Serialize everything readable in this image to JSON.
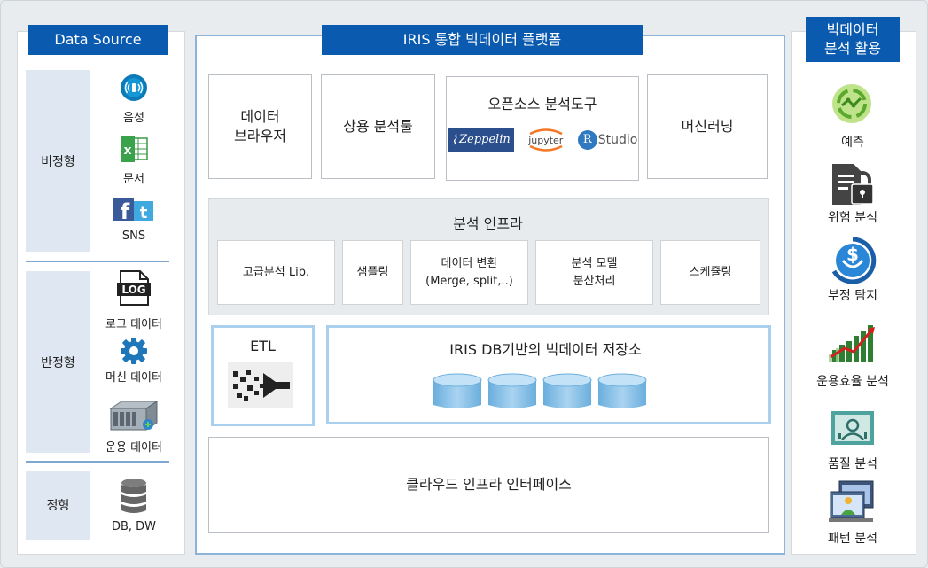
{
  "data_source": {
    "title": "Data Source",
    "categories": [
      {
        "label": "비정형",
        "items": [
          {
            "label": "음성",
            "icon": "audio-icon"
          },
          {
            "label": "문서",
            "icon": "excel-icon"
          },
          {
            "label": "SNS",
            "icon": "facebook-twitter-icon"
          }
        ]
      },
      {
        "label": "반정형",
        "items": [
          {
            "label": "로그 데이터",
            "icon": "log-file-icon",
            "icon_text": "LOG"
          },
          {
            "label": "머신 데이터",
            "icon": "gear-icon"
          },
          {
            "label": "운용 데이터",
            "icon": "server-icon"
          }
        ]
      },
      {
        "label": "정형",
        "items": [
          {
            "label": "DB, DW",
            "icon": "database-icon"
          }
        ]
      }
    ]
  },
  "platform": {
    "title": "IRIS 통합 빅데이터 플랫폼",
    "top_boxes": {
      "browser": "데이터\n브라우저",
      "commercial": "상용 분석툴",
      "opensource": {
        "title": "오픈소스 분석도구",
        "logos": [
          "Zeppelin",
          "jupyter",
          "R",
          "Studio"
        ]
      },
      "ml": "머신러닝"
    },
    "infra": {
      "title": "분석 인프라",
      "items": [
        "고급분석 Lib.",
        "샘플링",
        "데이터 변환\n(Merge, split,..)",
        "분석 모델\n분산처리",
        "스케쥴링"
      ]
    },
    "etl": "ETL",
    "storage": "IRIS DB기반의 빅데이터 저장소",
    "cloud": "클라우드 인프라 인터페이스"
  },
  "usage": {
    "title": "빅데이터\n분석 활용",
    "items": [
      {
        "label": "예측",
        "icon": "prediction-icon"
      },
      {
        "label": "위험 분석",
        "icon": "lock-document-icon"
      },
      {
        "label": "부정 탐지",
        "icon": "dollar-shield-icon"
      },
      {
        "label": "운용효율 분석",
        "icon": "growth-chart-icon"
      },
      {
        "label": "품질 분석",
        "icon": "quality-monitor-icon"
      },
      {
        "label": "패턴 분석",
        "icon": "pattern-windows-icon"
      }
    ]
  }
}
